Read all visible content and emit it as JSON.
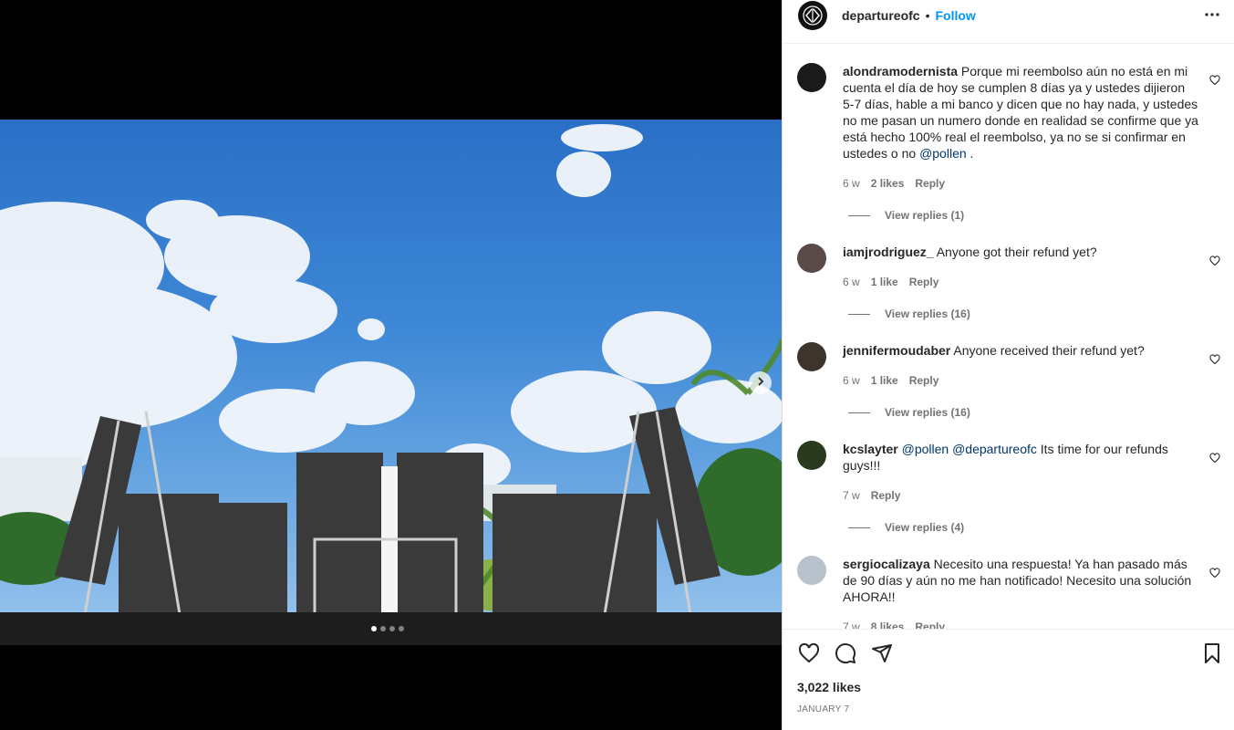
{
  "post": {
    "username": "departureofc",
    "separator": "•",
    "follow_label": "Follow",
    "likes": "3,022 likes",
    "date": "JANUARY 7",
    "carousel": {
      "slides": 4,
      "active_index": 0
    }
  },
  "comments": [
    {
      "user": "alondramodernista",
      "text": "Porque mi reembolso aún no está en mi cuenta el día de hoy se cumplen 8 días ya y ustedes dijieron 5-7 días, hable a mi banco y dicen que no hay nada, y ustedes no me pasan un numero donde en realidad se confirme que ya está hecho 100% real el reembolso, ya no se si confirmar en ustedes o no",
      "mention": "@pollen",
      "tail": " .",
      "age": "6 w",
      "likes": "2 likes",
      "reply": "Reply",
      "view_replies": "View replies (1)"
    },
    {
      "user": "iamjrodriguez_",
      "text": "Anyone got their refund yet?",
      "age": "6 w",
      "likes": "1 like",
      "reply": "Reply",
      "view_replies": "View replies (16)"
    },
    {
      "user": "jennifermoudaber",
      "text": "Anyone received their refund yet?",
      "age": "6 w",
      "likes": "1 like",
      "reply": "Reply",
      "view_replies": "View replies (16)"
    },
    {
      "user": "kcslayter",
      "mention1": "@pollen",
      "mention2": "@departureofc",
      "text": "Its time for our refunds guys!!!",
      "age": "7 w",
      "reply": "Reply",
      "view_replies": "View replies (4)"
    },
    {
      "user": "sergiocalizaya",
      "text": "Necesito una respuesta! Ya han pasado más de 90 días y aún no me han notificado! Necesito una solución AHORA!!",
      "age": "7 w",
      "likes": "8 likes",
      "reply": "Reply"
    }
  ],
  "icons": {
    "like": "heart-icon",
    "comment": "comment-icon",
    "share": "share-icon",
    "save": "bookmark-icon",
    "more": "more-icon",
    "next": "chevron-right-icon"
  },
  "colors": {
    "follow": "#0095f6",
    "mention": "#00376b",
    "muted": "#737373"
  }
}
